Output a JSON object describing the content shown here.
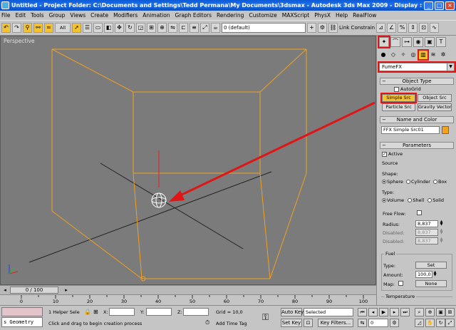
{
  "title_bar": {
    "title": "Untitled    - Project Folder: C:\\Documents and Settings\\Tedd Permana\\My Documents\\3dsmax    - Autodesk 3ds Max  2009    - Display : Software",
    "min": "_",
    "max": "□",
    "close": "×"
  },
  "menu": [
    "File",
    "Edit",
    "Tools",
    "Group",
    "Views",
    "Create",
    "Modifiers",
    "Animation",
    "Graph Editors",
    "Rendering",
    "Customize",
    "MAXScript",
    "PhysX",
    "Help",
    "RealFlow"
  ],
  "toolbar": {
    "selection_filter": "All",
    "layer": "0 (default)",
    "link_constraint": "Link Constrain"
  },
  "viewport": {
    "label": "Perspective"
  },
  "command_panel": {
    "category_dropdown": "FumeFX",
    "object_type": {
      "header": "Object Type",
      "autogrid": "AutoGrid",
      "buttons": [
        "Simple Src",
        "Object Src",
        "Particle Src",
        "Gravity Vector"
      ]
    },
    "name_color": {
      "header": "Name and Color",
      "name": "FFX Simple Src01",
      "color": "#f7a21b"
    },
    "parameters": {
      "header": "Parameters",
      "active": "Active",
      "source": "Source",
      "shape_label": "Shape:",
      "shape_options": [
        "Sphere",
        "Cylinder",
        "Box"
      ],
      "type_label": "Type:",
      "type_options": [
        "Volume",
        "Shell",
        "Solid"
      ],
      "free_flow": "Free Flow:",
      "radius_label": "Radius:",
      "radius_value": "8,837",
      "disabled1_label": "Disabled:",
      "disabled1_value": "8,837",
      "disabled2_label": "Disabled:",
      "disabled2_value": "8,837"
    },
    "fuel": {
      "header": "Fuel",
      "type_label": "Type:",
      "type_value": "Set",
      "amount_label": "Amount:",
      "amount_value": "100,0",
      "map_label": "Map:",
      "map_value": "None"
    },
    "temperature": {
      "header": "Temperature"
    }
  },
  "timeline": {
    "frame": "0 / 100",
    "ticks": [
      "0",
      "10",
      "20",
      "30",
      "40",
      "50",
      "60",
      "70",
      "80",
      "90",
      "100"
    ]
  },
  "status": {
    "maxscript": "s Geometry",
    "selected_count": "1 Helper Sele",
    "x_label": "X:",
    "y_label": "Y:",
    "z_label": "Z:",
    "grid": "Grid = 10,0",
    "auto_key": "Auto Key",
    "set_key": "Set Key",
    "key_mode": "Selected",
    "key_filters": "Key Filters...",
    "prompt": "Click and drag to begin creation process",
    "add_time_tag": "Add Time Tag",
    "current_frame": "0"
  },
  "colors": {
    "highlight": "#e01515",
    "box_wire": "#f0a020",
    "active_button": "#f2c230"
  }
}
